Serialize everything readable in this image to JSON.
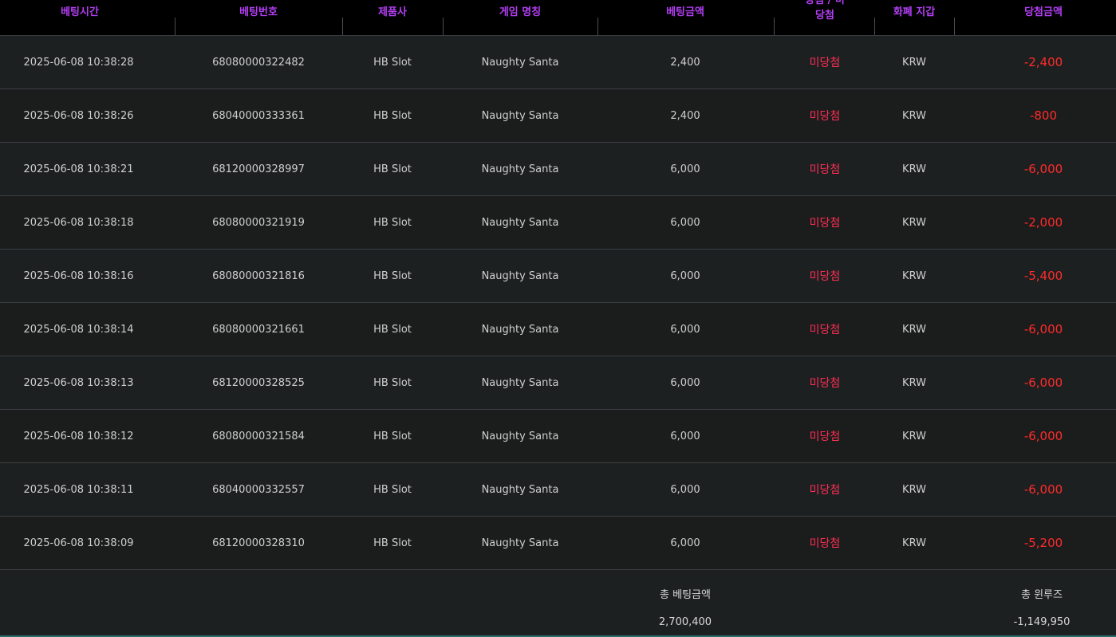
{
  "columns": [
    "베팅시간",
    "베팅번호",
    "제품사",
    "게임 명칭",
    "베팅금액",
    "당첨 / 미당첨",
    "화폐 지갑",
    "당첨금액"
  ],
  "rows": [
    {
      "time": "2025-06-08 10:38:28",
      "bet_id": "68080000322482",
      "provider": "HB Slot",
      "game": "Naughty Santa",
      "amount": "2,400",
      "result": "미당첨",
      "currency": "KRW",
      "win": "-2,400"
    },
    {
      "time": "2025-06-08 10:38:26",
      "bet_id": "68040000333361",
      "provider": "HB Slot",
      "game": "Naughty Santa",
      "amount": "2,400",
      "result": "미당첨",
      "currency": "KRW",
      "win": "-800"
    },
    {
      "time": "2025-06-08 10:38:21",
      "bet_id": "68120000328997",
      "provider": "HB Slot",
      "game": "Naughty Santa",
      "amount": "6,000",
      "result": "미당첨",
      "currency": "KRW",
      "win": "-6,000"
    },
    {
      "time": "2025-06-08 10:38:18",
      "bet_id": "68080000321919",
      "provider": "HB Slot",
      "game": "Naughty Santa",
      "amount": "6,000",
      "result": "미당첨",
      "currency": "KRW",
      "win": "-2,000"
    },
    {
      "time": "2025-06-08 10:38:16",
      "bet_id": "68080000321816",
      "provider": "HB Slot",
      "game": "Naughty Santa",
      "amount": "6,000",
      "result": "미당첨",
      "currency": "KRW",
      "win": "-5,400"
    },
    {
      "time": "2025-06-08 10:38:14",
      "bet_id": "68080000321661",
      "provider": "HB Slot",
      "game": "Naughty Santa",
      "amount": "6,000",
      "result": "미당첨",
      "currency": "KRW",
      "win": "-6,000"
    },
    {
      "time": "2025-06-08 10:38:13",
      "bet_id": "68120000328525",
      "provider": "HB Slot",
      "game": "Naughty Santa",
      "amount": "6,000",
      "result": "미당첨",
      "currency": "KRW",
      "win": "-6,000"
    },
    {
      "time": "2025-06-08 10:38:12",
      "bet_id": "68080000321584",
      "provider": "HB Slot",
      "game": "Naughty Santa",
      "amount": "6,000",
      "result": "미당첨",
      "currency": "KRW",
      "win": "-6,000"
    },
    {
      "time": "2025-06-08 10:38:11",
      "bet_id": "68040000332557",
      "provider": "HB Slot",
      "game": "Naughty Santa",
      "amount": "6,000",
      "result": "미당첨",
      "currency": "KRW",
      "win": "-6,000"
    },
    {
      "time": "2025-06-08 10:38:09",
      "bet_id": "68120000328310",
      "provider": "HB Slot",
      "game": "Naughty Santa",
      "amount": "6,000",
      "result": "미당첨",
      "currency": "KRW",
      "win": "-5,200"
    }
  ],
  "footer": {
    "total_bet_label": "총 베팅금액",
    "total_bet_value": "2,700,400",
    "total_winloss_label": "총 윈루즈",
    "total_winloss_value": "-1,149,950"
  },
  "colors": {
    "header_text": "#b43ef5",
    "result_text": "#ff2e55",
    "winloss_text": "#ff2b2b",
    "background": "#1b1d1e"
  }
}
